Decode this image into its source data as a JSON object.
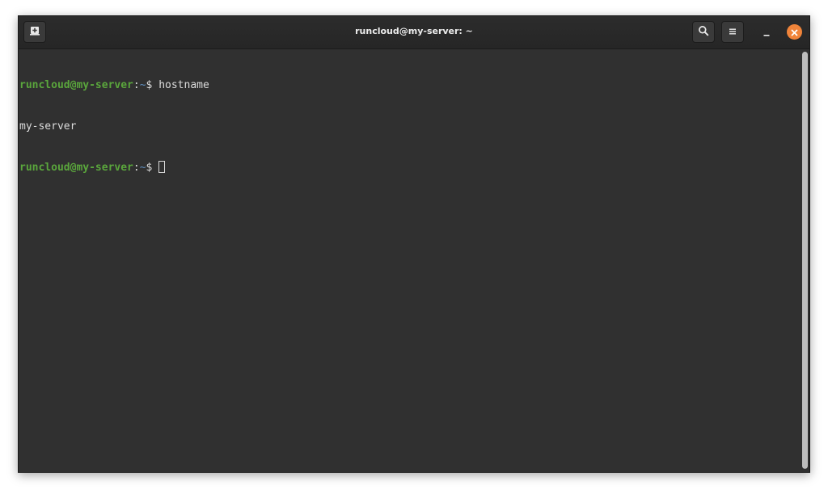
{
  "window": {
    "title": "runcloud@my-server: ~"
  },
  "titlebar": {
    "new_tab_icon": "new-tab-icon",
    "search_icon": "search-icon",
    "menu_icon": "hamburger-menu-icon",
    "minimize_icon": "minimize-icon",
    "close_icon": "close-icon"
  },
  "terminal": {
    "prompt_user_host": "runcloud@my-server",
    "prompt_sep": ":",
    "prompt_path": "~",
    "prompt_symbol": "$ ",
    "command_1": "hostname",
    "output_1": "my-server"
  },
  "colors": {
    "prompt_user": "#5aa63c",
    "prompt_path": "#5f8fc0",
    "terminal_bg": "#303030",
    "text": "#dcdcdc",
    "close_button": "#f0843a"
  }
}
